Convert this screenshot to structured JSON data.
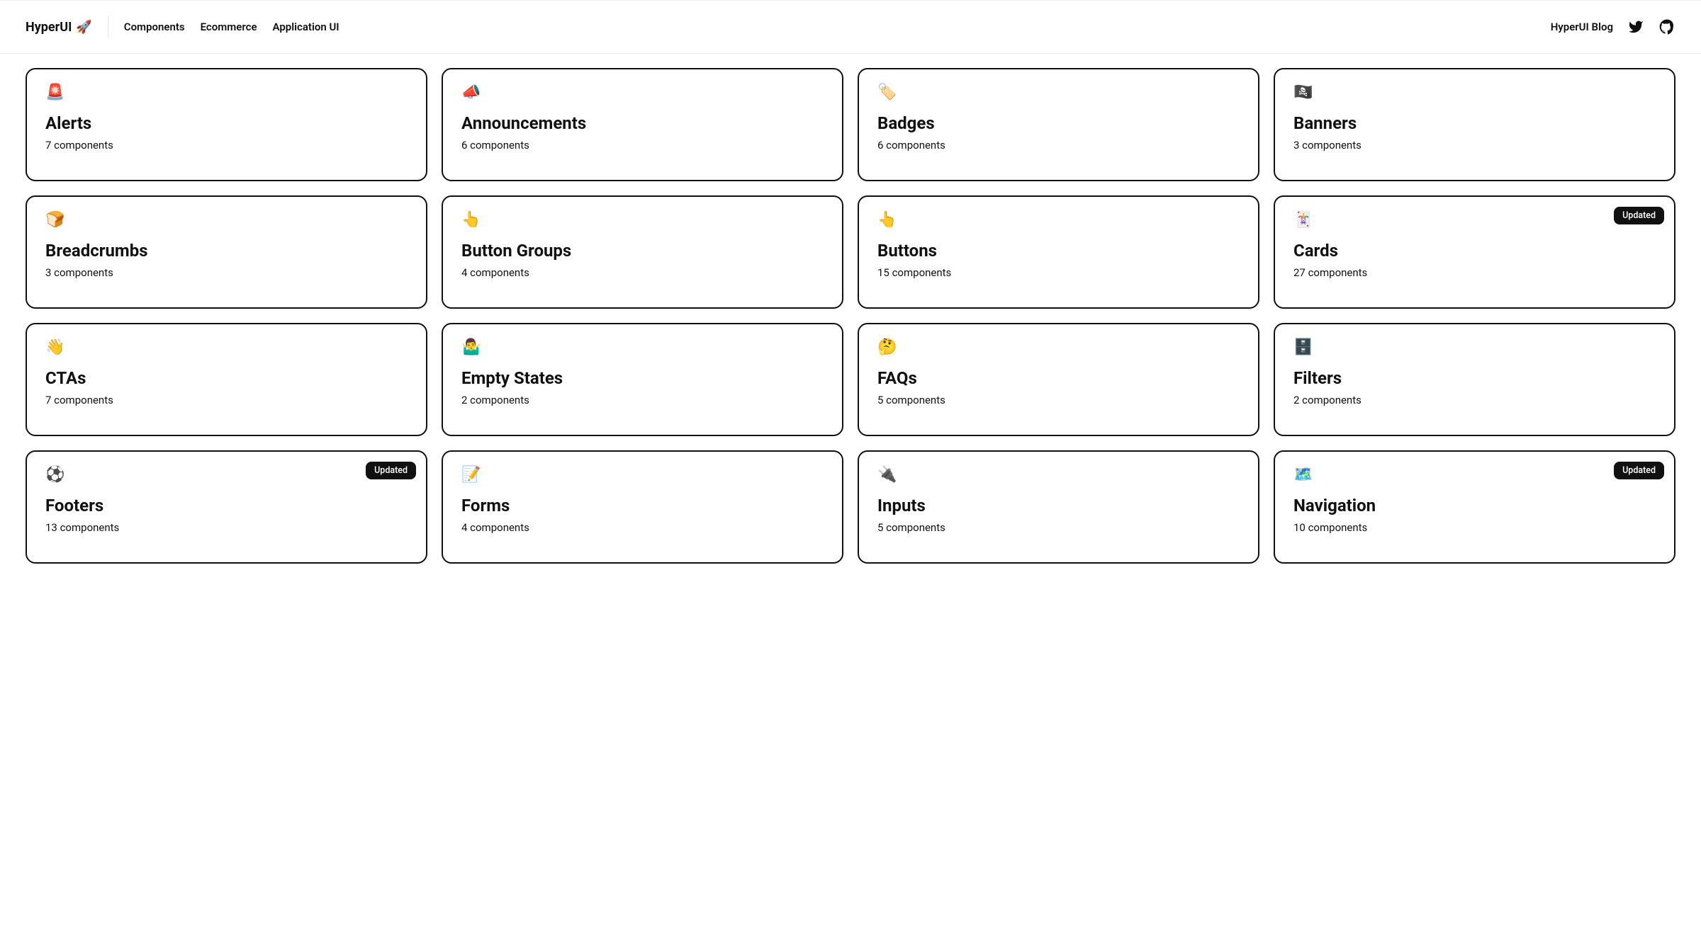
{
  "brand": {
    "name": "HyperUI",
    "emoji": "🚀"
  },
  "nav": [
    {
      "label": "Components"
    },
    {
      "label": "Ecommerce"
    },
    {
      "label": "Application UI"
    }
  ],
  "right": {
    "blog_label": "HyperUI Blog"
  },
  "badge_label": "Updated",
  "cards": [
    {
      "emoji": "🚨",
      "title": "Alerts",
      "count": "7 components",
      "badge": false
    },
    {
      "emoji": "📣",
      "title": "Announcements",
      "count": "6 components",
      "badge": false
    },
    {
      "emoji": "🏷️",
      "title": "Badges",
      "count": "6 components",
      "badge": false
    },
    {
      "emoji": "🏴‍☠️",
      "title": "Banners",
      "count": "3 components",
      "badge": false
    },
    {
      "emoji": "🍞",
      "title": "Breadcrumbs",
      "count": "3 components",
      "badge": false
    },
    {
      "emoji": "👆",
      "title": "Button Groups",
      "count": "4 components",
      "badge": false
    },
    {
      "emoji": "👆",
      "title": "Buttons",
      "count": "15 components",
      "badge": false
    },
    {
      "emoji": "🃏",
      "title": "Cards",
      "count": "27 components",
      "badge": true
    },
    {
      "emoji": "👋",
      "title": "CTAs",
      "count": "7 components",
      "badge": false
    },
    {
      "emoji": "🤷‍♂️",
      "title": "Empty States",
      "count": "2 components",
      "badge": false
    },
    {
      "emoji": "🤔",
      "title": "FAQs",
      "count": "5 components",
      "badge": false
    },
    {
      "emoji": "🗄️",
      "title": "Filters",
      "count": "2 components",
      "badge": false
    },
    {
      "emoji": "⚽",
      "title": "Footers",
      "count": "13 components",
      "badge": true
    },
    {
      "emoji": "📝",
      "title": "Forms",
      "count": "4 components",
      "badge": false
    },
    {
      "emoji": "🔌",
      "title": "Inputs",
      "count": "5 components",
      "badge": false
    },
    {
      "emoji": "🗺️",
      "title": "Navigation",
      "count": "10 components",
      "badge": true
    }
  ]
}
